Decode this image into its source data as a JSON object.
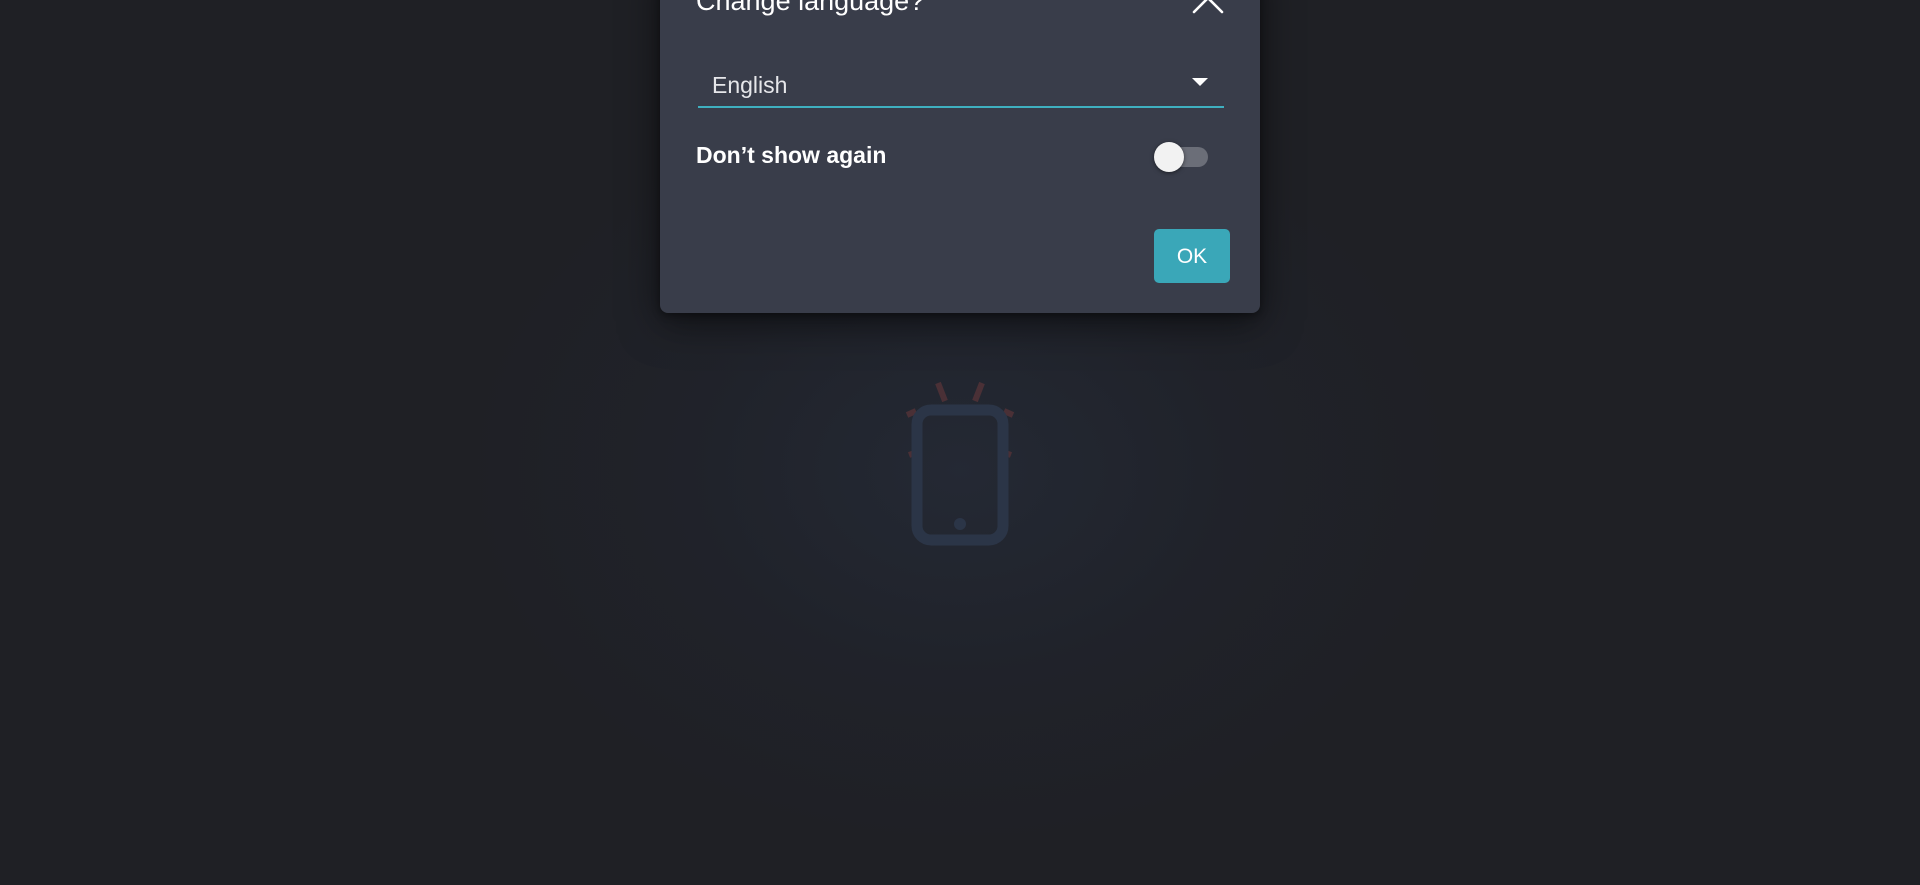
{
  "dialog": {
    "title": "Change language?",
    "close_icon": "chevron-up-icon",
    "language_select": {
      "selected": "English",
      "arrow_icon": "caret-down-icon"
    },
    "dont_show_again": {
      "label": "Don’t show again",
      "checked": false
    },
    "ok_label": "OK"
  },
  "background": {
    "illustration_icon": "phone-ringing-icon"
  },
  "colors": {
    "page_background": "#1f2025",
    "dialog_background": "#393d4a",
    "accent": "#3aa7b8",
    "illustration": "#2b3547",
    "ring_lines": "#4a3036"
  }
}
